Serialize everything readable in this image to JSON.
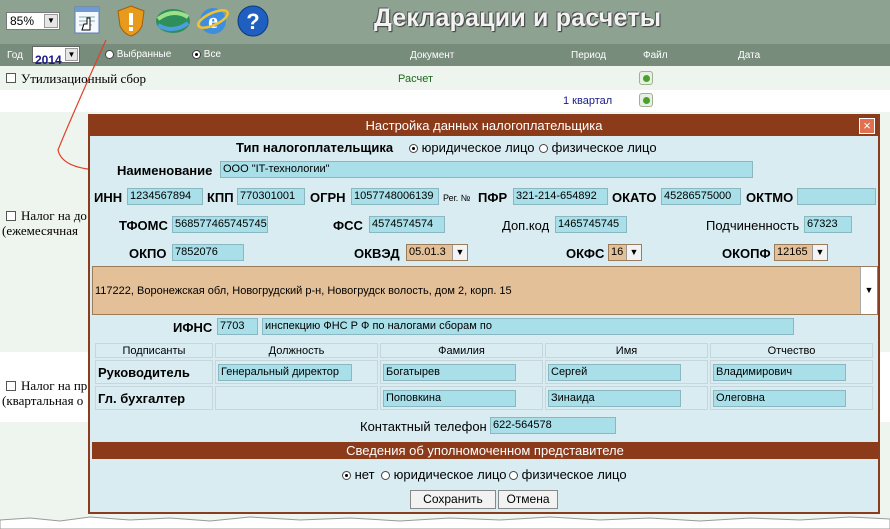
{
  "toolbar": {
    "zoom": "85%",
    "heading": "Декларации и расчеты",
    "icons": [
      "document-edit-icon",
      "shield-warning-icon",
      "exchange-icon",
      "ie-browser-icon",
      "help-icon"
    ]
  },
  "header": {
    "year_label": "Год",
    "year": "2014",
    "opt_selected": "Выбранные",
    "opt_all": "Все",
    "col_document": "Документ",
    "col_period": "Период",
    "col_file": "Файл",
    "col_date": "Дата"
  },
  "rows": [
    {
      "name": "Утилизационный сбор",
      "doc": "Расчет"
    },
    {
      "period": "1 квартал"
    },
    {
      "name_line1": "Налог на до",
      "name_line2": "(ежемесячная"
    },
    {
      "name_line1": "Налог на пр",
      "name_line2": "(квартальная о"
    }
  ],
  "dialog": {
    "title": "Настройка данных налогоплательщика",
    "type_label": "Тип налогоплательщика",
    "type_legal": "юридическое лицо",
    "type_person": "физическое лицо",
    "name_label": "Наименование",
    "name_value": "ООО \"IT-технологии\"",
    "inn_label": "ИНН",
    "inn": "1234567894",
    "kpp_label": "КПП",
    "kpp": "770301001",
    "ogrn_label": "ОГРН",
    "ogrn": "1057748006139",
    "reg_label": "Рег. №",
    "pfr_label": "ПФР",
    "pfr": "321-214-654892",
    "okato_label": "ОКАТО",
    "okato": "45286575000",
    "oktmo_label": "ОКТМО",
    "oktmo": "",
    "tfoms_label": "ТФОМС",
    "tfoms": "568577465745745",
    "fss_label": "ФСС",
    "fss": "4574574574",
    "dopkod_label": "Доп.код",
    "dopkod": "1465745745",
    "podch_label": "Подчиненность",
    "podch": "67323",
    "okpo_label": "ОКПО",
    "okpo": "7852076",
    "okved_label": "ОКВЭД",
    "okved": "05.01.3",
    "okfs_label": "ОКФС",
    "okfs": "16",
    "okopf_label": "ОКОПФ",
    "okopf": "12165",
    "address": "117222, Воронежская обл, Новогрудский р-н, Новогрудск волость, дом 2, корп. 15",
    "ifns_label": "ИФНС",
    "ifns_code": "7703",
    "ifns_name": "инспекцию ФНС Р Ф по налогами сборам по",
    "signers": {
      "headers": [
        "Подписанты",
        "Должность",
        "Фамилия",
        "Имя",
        "Отчество"
      ],
      "director": {
        "role": "Руководитель",
        "position": "Генеральный директор",
        "last": "Богатырев",
        "first": "Сергей",
        "middle": "Владимирович"
      },
      "accountant": {
        "role": "Гл. бухгалтер",
        "position": "",
        "last": "Поповкина",
        "first": "Зинаида",
        "middle": "Олеговна"
      }
    },
    "phone_label": "Контактный телефон",
    "phone": "622-564578",
    "repr_title": "Сведения об уполномоченном представителе",
    "repr_none": "нет",
    "repr_legal": "юридическое лицо",
    "repr_person": "физическое лицо",
    "save": "Сохранить",
    "cancel": "Отмена"
  }
}
